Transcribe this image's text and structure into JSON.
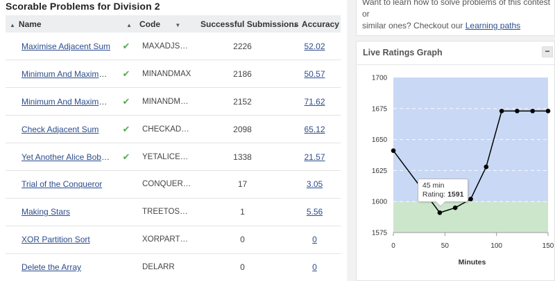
{
  "title": "Scorable Problems for Division 2",
  "table": {
    "headers": {
      "name": "Name",
      "code": "Code",
      "submissions": "Successful Submissions",
      "accuracy": "Accuracy"
    },
    "rows": [
      {
        "name": "Maximise Adjacent Sum",
        "solved": true,
        "code": "MAXADJS…",
        "submissions": "2226",
        "accuracy": "52.02"
      },
      {
        "name": "Minimum And Maximum I",
        "solved": true,
        "code": "MINANDMAX",
        "submissions": "2186",
        "accuracy": "50.57"
      },
      {
        "name": "Minimum And Maximum II",
        "solved": true,
        "code": "MINANDM…",
        "submissions": "2152",
        "accuracy": "71.62"
      },
      {
        "name": "Check Adjacent Sum",
        "solved": true,
        "code": "CHECKAD…",
        "submissions": "2098",
        "accuracy": "65.12"
      },
      {
        "name": "Yet Another Alice Bob Ga…",
        "solved": true,
        "code": "YETALICE…",
        "submissions": "1338",
        "accuracy": "21.57"
      },
      {
        "name": "Trial of the Conqueror",
        "solved": false,
        "code": "CONQUER…",
        "submissions": "17",
        "accuracy": "3.05"
      },
      {
        "name": "Making Stars",
        "solved": false,
        "code": "TREETOS…",
        "submissions": "1",
        "accuracy": "5.56"
      },
      {
        "name": "XOR Partition Sort",
        "solved": false,
        "code": "XORPART…",
        "submissions": "0",
        "accuracy": "0"
      },
      {
        "name": "Delete the Array",
        "solved": false,
        "code": "DELARR",
        "submissions": "0",
        "accuracy": "0"
      }
    ]
  },
  "learn": {
    "text_line1": "Want to learn how to solve problems of this contest or",
    "text_line2": "similar ones? Checkout our ",
    "link": "Learning paths"
  },
  "graph": {
    "title": "Live Ratings Graph",
    "collapse_label": "−",
    "tooltip": {
      "time": "45 min",
      "rating_label": "Rating: ",
      "rating_value": "1591"
    }
  },
  "chart_data": {
    "type": "line",
    "xlabel": "Minutes",
    "ylabel": "",
    "xlim": [
      0,
      150
    ],
    "ylim": [
      1575,
      1700
    ],
    "xticks": [
      0,
      50,
      100,
      150
    ],
    "yticks": [
      1575,
      1600,
      1625,
      1650,
      1675,
      1700
    ],
    "bands": [
      {
        "from": 1575,
        "to": 1600,
        "color": "#cce6cc"
      },
      {
        "from": 1600,
        "to": 1700,
        "color": "#c9d8f5"
      }
    ],
    "series": [
      {
        "x": [
          0,
          45,
          60,
          75,
          90,
          105,
          120,
          135,
          150
        ],
        "y": [
          1641,
          1591,
          1595,
          1602,
          1628,
          1673,
          1673,
          1673,
          1673
        ]
      }
    ],
    "highlight_index": 1
  }
}
